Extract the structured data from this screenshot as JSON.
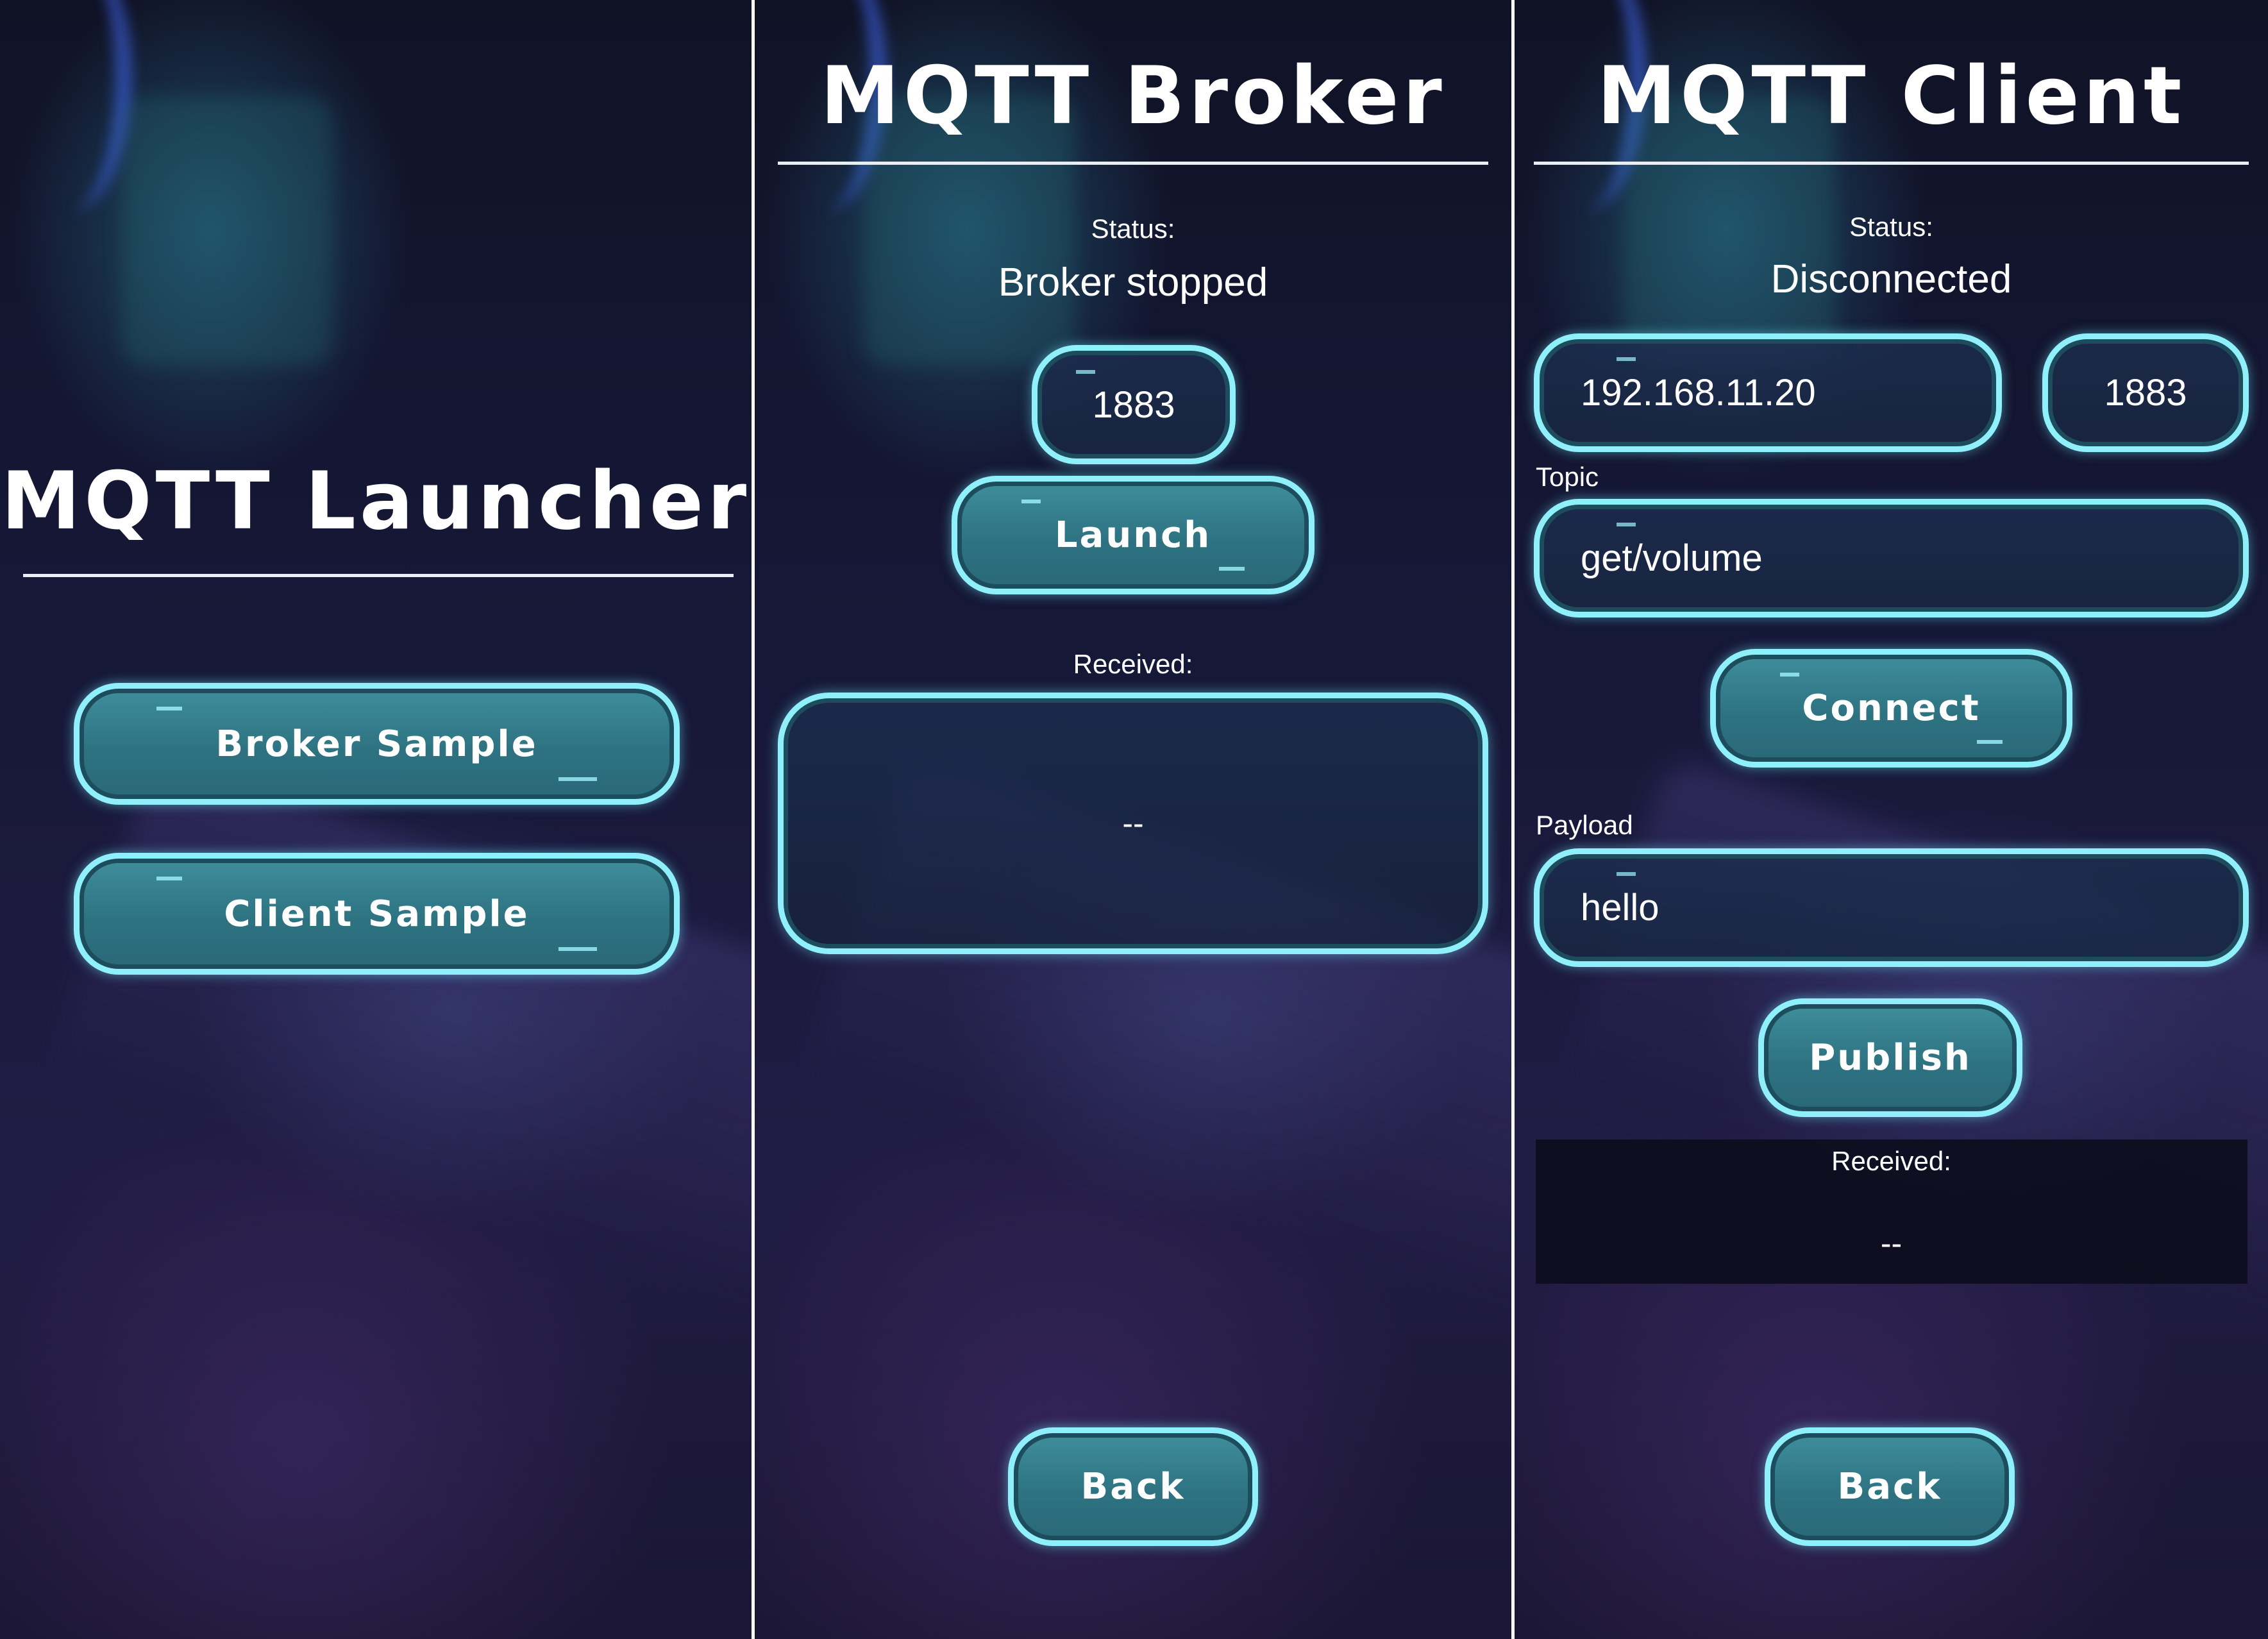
{
  "launcher": {
    "title": "MQTT Launcher",
    "broker_button": "Broker Sample",
    "client_button": "Client Sample"
  },
  "broker": {
    "title": "MQTT Broker",
    "status_label": "Status:",
    "status_value": "Broker stopped",
    "port_value": "1883",
    "launch_button": "Launch",
    "received_label": "Received:",
    "received_value": "--",
    "back_button": "Back"
  },
  "client": {
    "title": "MQTT Client",
    "status_label": "Status:",
    "status_value": "Disconnected",
    "host_value": "192.168.11.20",
    "port_value": "1883",
    "topic_label": "Topic",
    "topic_value": "get/volume",
    "connect_button": "Connect",
    "payload_label": "Payload",
    "payload_value": "hello",
    "publish_button": "Publish",
    "received_label": "Received:",
    "received_value": "--",
    "back_button": "Back"
  },
  "colors": {
    "button_fill": "#2e7382",
    "button_border": "#8ff0fb",
    "text": "#ffffff",
    "divider": "#e9eef2"
  }
}
